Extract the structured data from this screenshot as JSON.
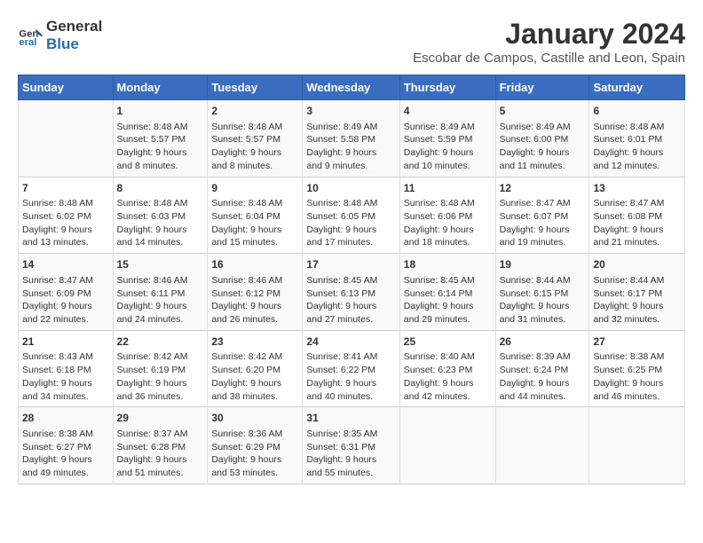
{
  "logo": {
    "line1": "General",
    "line2": "Blue"
  },
  "title": "January 2024",
  "subtitle": "Escobar de Campos, Castille and Leon, Spain",
  "days_of_week": [
    "Sunday",
    "Monday",
    "Tuesday",
    "Wednesday",
    "Thursday",
    "Friday",
    "Saturday"
  ],
  "weeks": [
    [
      {
        "day": "",
        "info": ""
      },
      {
        "day": "1",
        "info": "Sunrise: 8:48 AM\nSunset: 5:57 PM\nDaylight: 9 hours\nand 8 minutes."
      },
      {
        "day": "2",
        "info": "Sunrise: 8:48 AM\nSunset: 5:57 PM\nDaylight: 9 hours\nand 8 minutes."
      },
      {
        "day": "3",
        "info": "Sunrise: 8:49 AM\nSunset: 5:58 PM\nDaylight: 9 hours\nand 9 minutes."
      },
      {
        "day": "4",
        "info": "Sunrise: 8:49 AM\nSunset: 5:59 PM\nDaylight: 9 hours\nand 10 minutes."
      },
      {
        "day": "5",
        "info": "Sunrise: 8:49 AM\nSunset: 6:00 PM\nDaylight: 9 hours\nand 11 minutes."
      },
      {
        "day": "6",
        "info": "Sunrise: 8:48 AM\nSunset: 6:01 PM\nDaylight: 9 hours\nand 12 minutes."
      }
    ],
    [
      {
        "day": "7",
        "info": "Sunrise: 8:48 AM\nSunset: 6:02 PM\nDaylight: 9 hours\nand 13 minutes."
      },
      {
        "day": "8",
        "info": "Sunrise: 8:48 AM\nSunset: 6:03 PM\nDaylight: 9 hours\nand 14 minutes."
      },
      {
        "day": "9",
        "info": "Sunrise: 8:48 AM\nSunset: 6:04 PM\nDaylight: 9 hours\nand 15 minutes."
      },
      {
        "day": "10",
        "info": "Sunrise: 8:48 AM\nSunset: 6:05 PM\nDaylight: 9 hours\nand 17 minutes."
      },
      {
        "day": "11",
        "info": "Sunrise: 8:48 AM\nSunset: 6:06 PM\nDaylight: 9 hours\nand 18 minutes."
      },
      {
        "day": "12",
        "info": "Sunrise: 8:47 AM\nSunset: 6:07 PM\nDaylight: 9 hours\nand 19 minutes."
      },
      {
        "day": "13",
        "info": "Sunrise: 8:47 AM\nSunset: 6:08 PM\nDaylight: 9 hours\nand 21 minutes."
      }
    ],
    [
      {
        "day": "14",
        "info": "Sunrise: 8:47 AM\nSunset: 6:09 PM\nDaylight: 9 hours\nand 22 minutes."
      },
      {
        "day": "15",
        "info": "Sunrise: 8:46 AM\nSunset: 6:11 PM\nDaylight: 9 hours\nand 24 minutes."
      },
      {
        "day": "16",
        "info": "Sunrise: 8:46 AM\nSunset: 6:12 PM\nDaylight: 9 hours\nand 26 minutes."
      },
      {
        "day": "17",
        "info": "Sunrise: 8:45 AM\nSunset: 6:13 PM\nDaylight: 9 hours\nand 27 minutes."
      },
      {
        "day": "18",
        "info": "Sunrise: 8:45 AM\nSunset: 6:14 PM\nDaylight: 9 hours\nand 29 minutes."
      },
      {
        "day": "19",
        "info": "Sunrise: 8:44 AM\nSunset: 6:15 PM\nDaylight: 9 hours\nand 31 minutes."
      },
      {
        "day": "20",
        "info": "Sunrise: 8:44 AM\nSunset: 6:17 PM\nDaylight: 9 hours\nand 32 minutes."
      }
    ],
    [
      {
        "day": "21",
        "info": "Sunrise: 8:43 AM\nSunset: 6:18 PM\nDaylight: 9 hours\nand 34 minutes."
      },
      {
        "day": "22",
        "info": "Sunrise: 8:42 AM\nSunset: 6:19 PM\nDaylight: 9 hours\nand 36 minutes."
      },
      {
        "day": "23",
        "info": "Sunrise: 8:42 AM\nSunset: 6:20 PM\nDaylight: 9 hours\nand 38 minutes."
      },
      {
        "day": "24",
        "info": "Sunrise: 8:41 AM\nSunset: 6:22 PM\nDaylight: 9 hours\nand 40 minutes."
      },
      {
        "day": "25",
        "info": "Sunrise: 8:40 AM\nSunset: 6:23 PM\nDaylight: 9 hours\nand 42 minutes."
      },
      {
        "day": "26",
        "info": "Sunrise: 8:39 AM\nSunset: 6:24 PM\nDaylight: 9 hours\nand 44 minutes."
      },
      {
        "day": "27",
        "info": "Sunrise: 8:38 AM\nSunset: 6:25 PM\nDaylight: 9 hours\nand 46 minutes."
      }
    ],
    [
      {
        "day": "28",
        "info": "Sunrise: 8:38 AM\nSunset: 6:27 PM\nDaylight: 9 hours\nand 49 minutes."
      },
      {
        "day": "29",
        "info": "Sunrise: 8:37 AM\nSunset: 6:28 PM\nDaylight: 9 hours\nand 51 minutes."
      },
      {
        "day": "30",
        "info": "Sunrise: 8:36 AM\nSunset: 6:29 PM\nDaylight: 9 hours\nand 53 minutes."
      },
      {
        "day": "31",
        "info": "Sunrise: 8:35 AM\nSunset: 6:31 PM\nDaylight: 9 hours\nand 55 minutes."
      },
      {
        "day": "",
        "info": ""
      },
      {
        "day": "",
        "info": ""
      },
      {
        "day": "",
        "info": ""
      }
    ]
  ]
}
